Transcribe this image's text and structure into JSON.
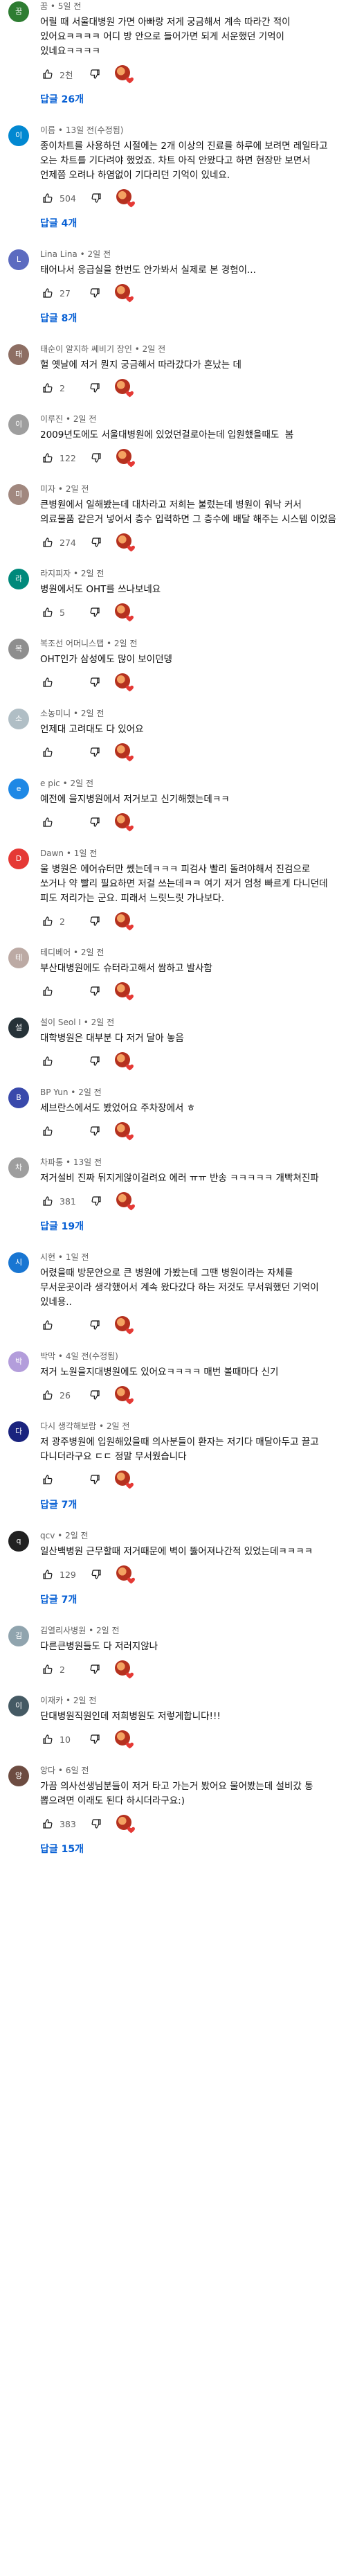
{
  "comments": [
    {
      "author": "꿈",
      "time": "5일 전",
      "avatar_initial": "꿈",
      "avatar_color": "#2e7d32",
      "text": "어릴 때 서울대병원 가면 아빠랑 저게 궁금해서 계속 따라간 적이 있어요ㅋㅋㅋㅋ 어디 방 안으로 들어가면 되게 서운했던 기억이 있네요ㅋㅋㅋㅋ",
      "likes": "2천",
      "replies": "답글 26개"
    },
    {
      "author": "이름",
      "time": "13일 전(수정됨)",
      "avatar_initial": "이름",
      "avatar_color": "#0288d1",
      "text": "종이차트를 사용하던 시절에는 2개 이상의 진료를 하루에 보려면 레일타고 오는 차트를 기다려야 했었죠. 차트 아직 안왔다고 하면 현장만 보면서 언제쯤 오려나 하염없이 기다리던 기억이 있네요.",
      "likes": "504",
      "replies": "답글 4개"
    },
    {
      "author": "Lina Lina",
      "time": "2일 전",
      "avatar_initial": "L",
      "avatar_color": "#5c6bc0",
      "text": "태어나서 응급실을 한번도 안가봐서 실제로 본 경험이...",
      "likes": "27",
      "replies": "답글 8개"
    },
    {
      "author": "태순이 알지하 쎄비기 장인",
      "time": "2일 전",
      "avatar_initial": "태",
      "avatar_color": "#8d6e63",
      "text": "헐 옛날에 저거 뭔지 궁금해서 따라갔다가 혼났는 데",
      "likes": "2",
      "replies": ""
    },
    {
      "author": "이루진",
      "time": "2일 전",
      "avatar_initial": "이",
      "avatar_color": "#9e9e9e",
      "text": "2009년도에도 서울대병원에 있었던걸로아는데 입원했을때도  봄",
      "likes": "122",
      "replies": ""
    },
    {
      "author": "미자",
      "time": "2일 전",
      "avatar_initial": "미",
      "avatar_color": "#a1887f",
      "text": "큰병원에서 일해봤는데 대차라고 저희는 불렀는데 병원이 워낙 커서 의료물품 같은거 넣어서 층수 입력하면 그 층수에 배달 해주는 시스템 이었음",
      "likes": "274",
      "replies": ""
    },
    {
      "author": "라지피자",
      "time": "2일 전",
      "avatar_initial": "라",
      "avatar_color": "#00897b",
      "text": "병원에서도 OHT를 쓰나보네요",
      "likes": "5",
      "replies": ""
    },
    {
      "author": "복조선 어머니스탭",
      "time": "2일 전",
      "avatar_initial": "복",
      "avatar_color": "#8e8e8e",
      "text": "OHT인가 삼성에도 많이 보이던뎅",
      "likes": "",
      "replies": ""
    },
    {
      "author": "소농미니",
      "time": "2일 전",
      "avatar_initial": "소",
      "avatar_color": "#b0bec5",
      "text": "언제대 고려대도 다 있어요",
      "likes": "",
      "replies": ""
    },
    {
      "author": "e pic",
      "time": "2일 전",
      "avatar_initial": "e",
      "avatar_color": "#1e88e5",
      "text": "예전에 을지병원에서 저거보고 신기해했는데ㅋㅋ",
      "likes": "",
      "replies": ""
    },
    {
      "author": "Dawn",
      "time": "1일 전",
      "avatar_initial": "D",
      "avatar_color": "#e53935",
      "text": "울 병원은 에어슈터만 쎘는데ㅋㅋㅋ 피검사 빨리 돌려야해서 진검으로 쏘거나 약 빨리 필요하면 저걸 쓰는데ㅋㅋ 여기 저거 엄청 빠르게 다니던데 피도 저리가는 군요. 피래서 느릿느릿 가나보다.",
      "likes": "2",
      "replies": ""
    },
    {
      "author": "테디베어",
      "time": "2일 전",
      "avatar_initial": "테",
      "avatar_color": "#bcaaa4",
      "text": "부산대병원에도 슈터라고해서 쌈하고 발사함",
      "likes": "",
      "replies": ""
    },
    {
      "author": "설이 Seol I",
      "time": "2일 전",
      "avatar_initial": "설",
      "avatar_color": "#263238",
      "text": "대학병원은 대부분 다 저거 달아 놓음",
      "likes": "",
      "replies": ""
    },
    {
      "author": "BP Yun",
      "time": "2일 전",
      "avatar_initial": "B",
      "avatar_color": "#3949ab",
      "text": "세브란스에서도 봤었어요 주차장에서 ㅎ",
      "likes": "",
      "replies": ""
    },
    {
      "author": "차파통",
      "time": "13일 전",
      "avatar_initial": "차",
      "avatar_color": "#9e9e9e",
      "text": "저거설비 진짜 뒤지게않이걸려요 에러 ㅠㅠ 반송 ㅋㅋㅋㅋㅋ 개빡쳐진파",
      "likes": "381",
      "replies": "답글 19개"
    },
    {
      "author": "시현",
      "time": "1일 전",
      "avatar_initial": "시",
      "avatar_color": "#1976d2",
      "text": "어렸을때 방문안으로 큰 병원에 가봤는데 그땐 병원이라는 자체를 무서운곳이라 생각했어서 계속 왔다갔다 하는 저것도 무서워했던 기억이 있네용..",
      "likes": "",
      "replies": ""
    },
    {
      "author": "박막",
      "time": "4일 전(수정됨)",
      "avatar_initial": "박",
      "avatar_color": "#b39ddb",
      "text": "저거 노원을지대병원에도 있어요ㅋㅋㅋㅋ 매번 볼때마다 신기",
      "likes": "26",
      "replies": ""
    },
    {
      "author": "다시 생각해보람",
      "time": "2일 전",
      "avatar_initial": "다",
      "avatar_color": "#1a237e",
      "text": "저 광주병원에 입원해있을때 의사분들이 환자는 저기다 매달아두고 끌고 다니더라구요 ㄷㄷ 정말 무서웠습니다",
      "likes": "",
      "replies": "답글 7개"
    },
    {
      "author": "qcv",
      "time": "2일 전",
      "avatar_initial": "q",
      "avatar_color": "#212121",
      "text": "일산백병원 근무할때 저거때문에 벽이 뚫어져나간적 있었는데ㅋㅋㅋㅋ",
      "likes": "129",
      "replies": "답글 7개"
    },
    {
      "author": "김열리사병원",
      "time": "2일 전",
      "avatar_initial": "김",
      "avatar_color": "#90a4ae",
      "text": "다른큰병원들도 다 저러지않나",
      "likes": "2",
      "replies": ""
    },
    {
      "author": "이재카",
      "time": "2일 전",
      "avatar_initial": "이",
      "avatar_color": "#455a64",
      "text": "단대병원직원인데 저희병원도 저렇게합니다!!!",
      "likes": "10",
      "replies": ""
    },
    {
      "author": "앙다",
      "time": "6일 전",
      "avatar_initial": "앙",
      "avatar_color": "#6d4c41",
      "text": "가끔 의사선생님분들이 저거 타고 가는거 봤어요 물어봤는데 설비갔 통 뽑으려면 이래도 된다 하시더라구요:)",
      "likes": "383",
      "replies": "답글 15개"
    }
  ],
  "icons": {
    "like": "thumbs-up-icon",
    "dislike": "thumbs-down-icon",
    "creator_heart": "creator-heart-icon"
  },
  "colors": {
    "reply_link": "#065fd4",
    "meta_text": "#606060",
    "heart": "#e53935"
  }
}
